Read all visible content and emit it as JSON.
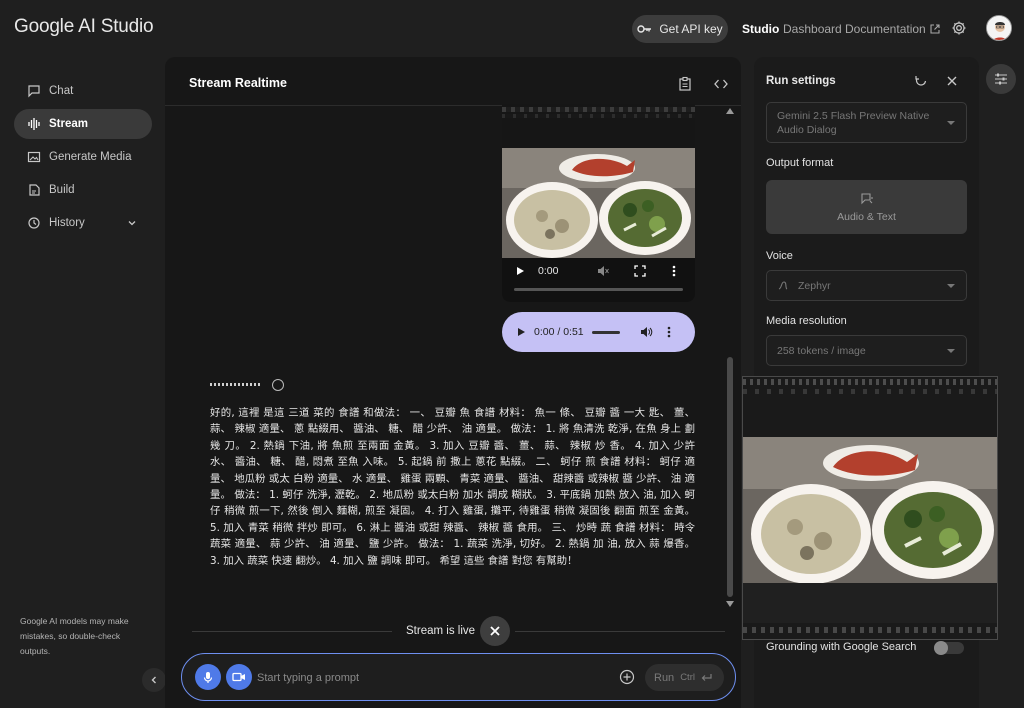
{
  "header": {
    "logo": "Google AI Studio",
    "api_key_label": "Get API key",
    "nav": {
      "studio": "Studio",
      "dashboard": "Dashboard",
      "documentation": "Documentation"
    }
  },
  "sidebar": {
    "items": [
      {
        "label": "Chat",
        "icon": "chat-icon"
      },
      {
        "label": "Stream",
        "icon": "stream-icon",
        "active": true
      },
      {
        "label": "Generate Media",
        "icon": "media-icon"
      },
      {
        "label": "Build",
        "icon": "build-icon"
      },
      {
        "label": "History",
        "icon": "history-icon"
      }
    ],
    "disclaimer": "Google AI models may make mistakes, so double-check outputs."
  },
  "main": {
    "title": "Stream Realtime",
    "video": {
      "time": "0:00"
    },
    "audio": {
      "time": "0:00 / 0:51"
    },
    "response": "好的, 這裡 是這 三道 菜的 食譜 和做法： 一、 豆瓣 魚 食譜 材料： 魚一 條、 豆瓣 醬 一大 匙、 薑、 蒜、 辣椒 適量、 蔥 點綴用、 醬油、 糖、 醋 少許、 油 適量。 做法： 1. 將 魚清洗 乾淨, 在魚 身上 劃幾 刀。 2. 熱鍋 下油, 將 魚煎 至兩面 金黃。 3. 加入 豆瓣 醬、 薑、 蒜、 辣椒 炒 香。 4. 加入 少許 水、 醬油、 糖、 醋, 悶煮 至魚 入味。 5. 起鍋 前 撒上 蔥花 點綴。 二、 蚵仔 煎 食譜 材料： 蚵仔 適量、 地瓜粉 或太 白粉 適量、 水 適量、 雞蛋 兩顆、 青菜 適量、 醬油、 甜辣醬 或辣椒 醬 少許、 油 適量。 做法： 1. 蚵仔 洗淨, 瀝乾。 2. 地瓜粉 或太白粉 加水 調成 糊狀。 3. 平底鍋 加熱 放入 油, 加入 蚵仔 稍微 煎一下, 然後 倒入 麵糊, 煎至 凝固。 4. 打入 雞蛋, 攤平, 待雞蛋 稍微 凝固後 翻面 煎至 金黃。 5. 加入 青菜 稍微 拌炒 即可。 6. 淋上 醬油 或甜 辣醬、 辣椒 醬 食用。 三、 炒時 蔬 食譜 材料： 時令 蔬菜 適量、 蒜 少許、 油 適量、 鹽 少許。 做法： 1. 蔬菜 洗淨, 切好。 2. 熱鍋 加 油, 放入 蒜 爆香。 3. 加入 蔬菜 快速 翻炒。 4. 加入 鹽 調味 即可。 希望 這些 食譜 對您 有幫助！",
    "live_status": "Stream is live",
    "prompt_placeholder": "Start typing a prompt",
    "run_label": "Run",
    "run_shortcut": "Ctrl"
  },
  "settings": {
    "title": "Run settings",
    "model": "Gemini 2.5 Flash Preview Native Audio Dialog",
    "output_format_label": "Output format",
    "output_format_value": "Audio & Text",
    "voice_label": "Voice",
    "voice_value": "Zephyr",
    "media_resolution_label": "Media resolution",
    "media_resolution_value": "258 tokens / image",
    "grounding_label": "Grounding with Google Search",
    "grounding_enabled": false
  },
  "colors": {
    "accent": "#4f7ae8",
    "audio_player": "#c5c1f5",
    "prompt_border": "#6e8ff0"
  }
}
